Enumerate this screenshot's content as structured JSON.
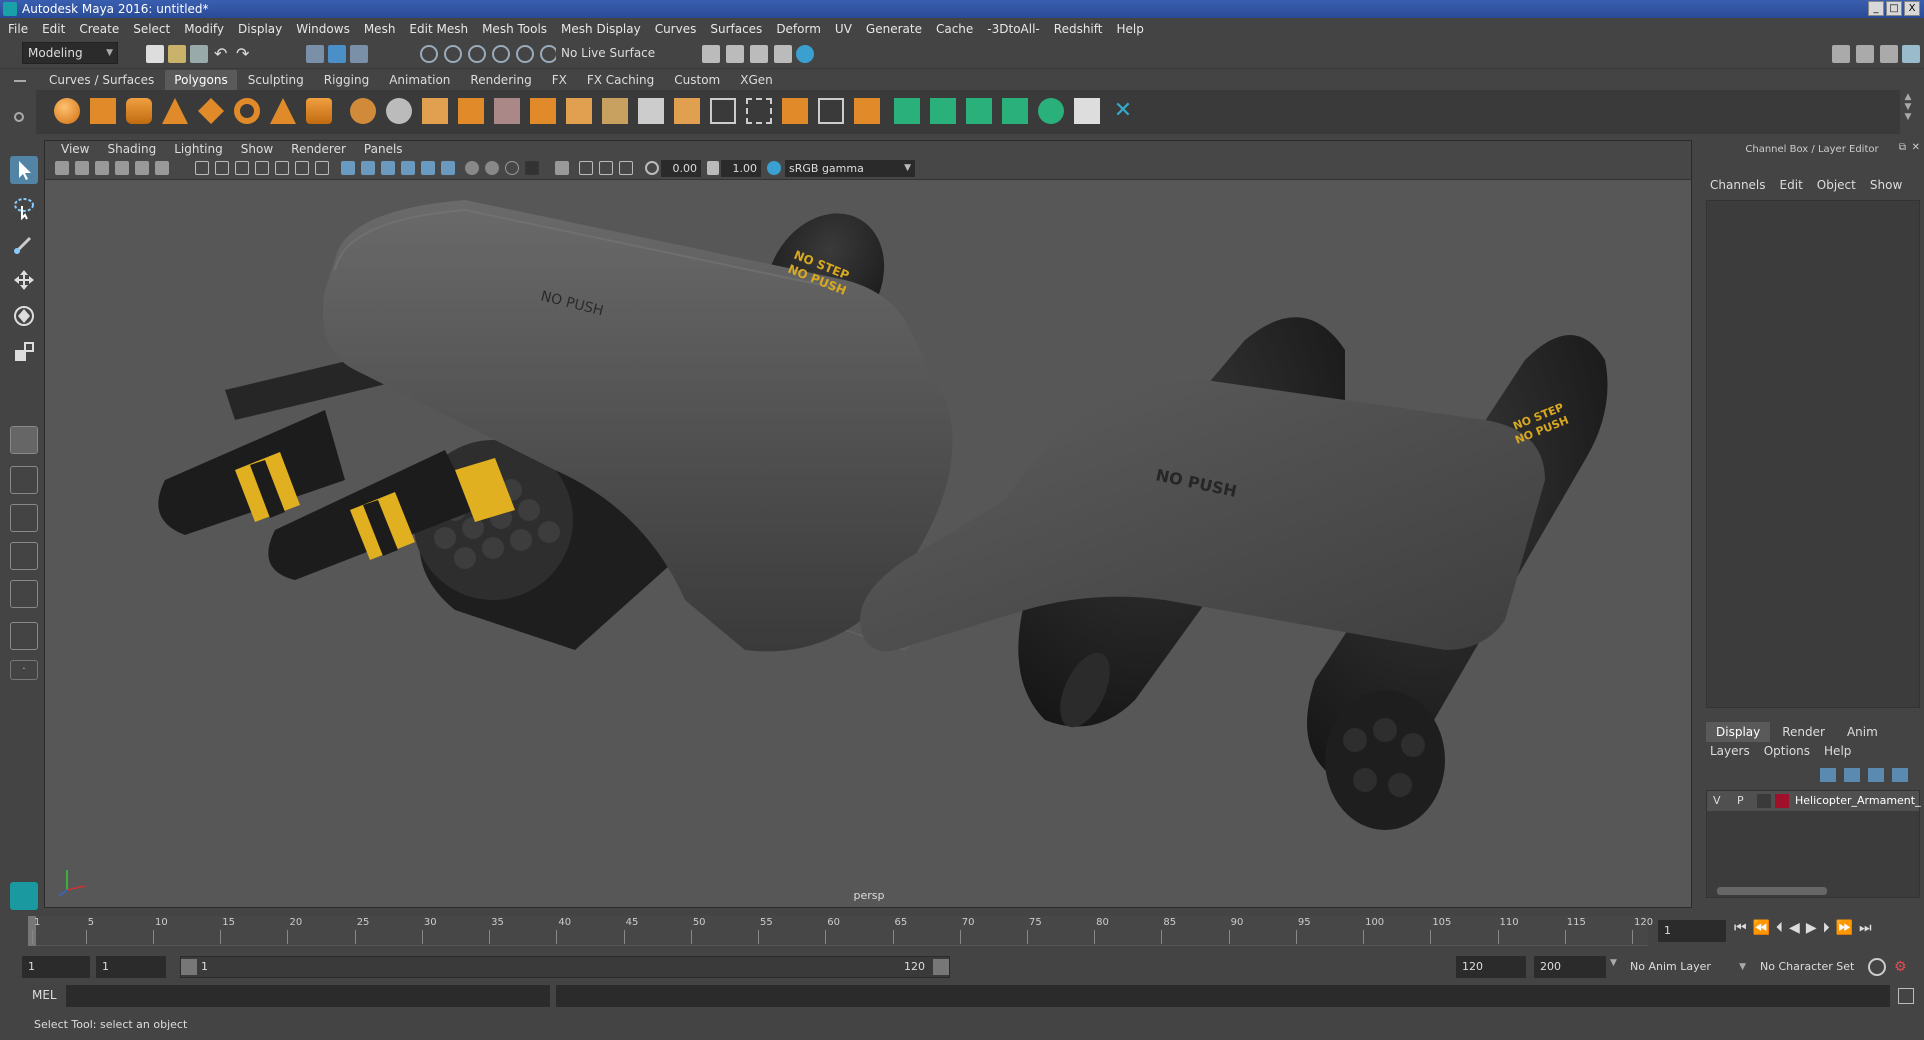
{
  "window": {
    "title": "Autodesk Maya 2016: untitled*",
    "btn_min": "_",
    "btn_max": "□",
    "btn_close": "X"
  },
  "menubar": [
    "File",
    "Edit",
    "Create",
    "Select",
    "Modify",
    "Display",
    "Windows",
    "Mesh",
    "Edit Mesh",
    "Mesh Tools",
    "Mesh Display",
    "Curves",
    "Surfaces",
    "Deform",
    "UV",
    "Generate",
    "Cache",
    "-3DtoAll-",
    "Redshift",
    "Help"
  ],
  "statusline": {
    "menuset": "Modeling",
    "live_surface": "No Live Surface"
  },
  "shelf": {
    "tabs": [
      "Curves / Surfaces",
      "Polygons",
      "Sculpting",
      "Rigging",
      "Animation",
      "Rendering",
      "FX",
      "FX Caching",
      "Custom",
      "XGen"
    ],
    "active_tab": "Polygons"
  },
  "viewport": {
    "menus": [
      "View",
      "Shading",
      "Lighting",
      "Show",
      "Renderer",
      "Panels"
    ],
    "field_exposure": "0.00",
    "field_gamma": "1.00",
    "color_space": "sRGB gamma",
    "camera_label": "persp",
    "decals": {
      "no_push": "NO PUSH",
      "no_step": "NO STEP",
      "no_push_small": "NO PUSH"
    }
  },
  "channelbox": {
    "title": "Channel Box / Layer Editor",
    "menus": [
      "Channels",
      "Edit",
      "Object",
      "Show"
    ],
    "layer_tabs": [
      "Display",
      "Render",
      "Anim"
    ],
    "active_layer_tab": "Display",
    "layer_menus": [
      "Layers",
      "Options",
      "Help"
    ],
    "layer": {
      "v": "V",
      "p": "P",
      "name": "Helicopter_Armament_",
      "color": "#a0102a"
    }
  },
  "timeline": {
    "ticks": [
      "1",
      "5",
      "10",
      "15",
      "20",
      "25",
      "30",
      "35",
      "40",
      "45",
      "50",
      "55",
      "60",
      "65",
      "70",
      "75",
      "80",
      "85",
      "90",
      "95",
      "100",
      "105",
      "110",
      "115",
      "120"
    ],
    "current_frame": "1"
  },
  "range": {
    "start": "1",
    "playback_start": "1",
    "slider_start": "1",
    "slider_end": "120",
    "playback_end": "120",
    "end": "200",
    "anim_layer": "No Anim Layer",
    "character_set": "No Character Set"
  },
  "cmdline": {
    "label": "MEL"
  },
  "helpline": {
    "text": "Select Tool: select an object"
  }
}
